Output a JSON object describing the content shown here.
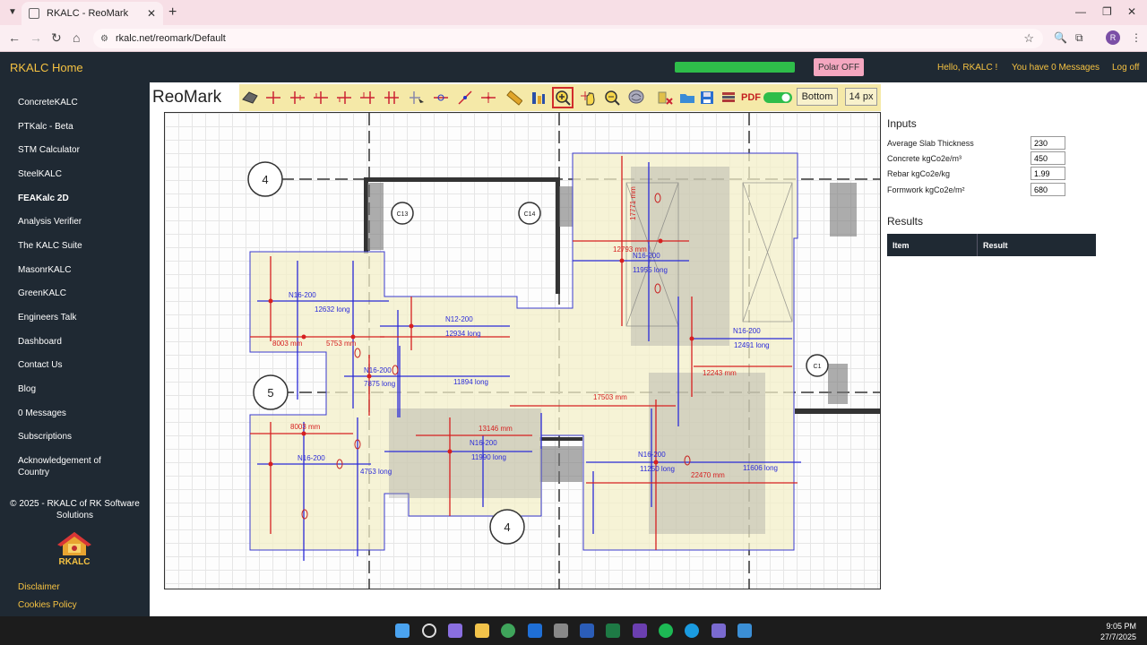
{
  "browser": {
    "tab_title": "RKALC - ReoMark",
    "url": "rkalc.net/reomark/Default",
    "avatar_letter": "R"
  },
  "header": {
    "brand": "RKALC Home",
    "progress_percent": 100,
    "polar_button": "Polar OFF",
    "greeting": "Hello, RKALC !",
    "messages": "You have 0 Messages",
    "logout": "Log off"
  },
  "sidebar": {
    "items": [
      {
        "label": "ConcreteKALC"
      },
      {
        "label": "PTKalc - Beta"
      },
      {
        "label": "STM Calculator"
      },
      {
        "label": "SteelKALC"
      },
      {
        "label": "FEAKalc 2D"
      },
      {
        "label": "Analysis Verifier"
      },
      {
        "label": "The KALC Suite"
      },
      {
        "label": "MasonrKALC"
      },
      {
        "label": "GreenKALC"
      },
      {
        "label": "Engineers Talk"
      },
      {
        "label": "Dashboard"
      },
      {
        "label": "Contact Us"
      },
      {
        "label": "Blog"
      },
      {
        "label": "0 Messages"
      },
      {
        "label": "Subscriptions"
      },
      {
        "label": "Acknowledgement of"
      }
    ],
    "ack_line2": "Country",
    "copyright_line1": "© 2025 - RKALC of RK Software",
    "copyright_line2": "Solutions",
    "logo_text": "RKALC",
    "disclaimer": "Disclaimer",
    "cookies": "Cookies Policy"
  },
  "main": {
    "title": "ReoMark",
    "toolbar": {
      "pdf_label": "PDF",
      "bottom_button": "Bottom",
      "px_button": "14 px"
    }
  },
  "drawing": {
    "grid_labels": [
      "4",
      "5",
      "4"
    ],
    "column_labels": [
      "C13",
      "C14",
      "C1"
    ],
    "bar_labels": [
      "N16-200",
      "12632 long",
      "N12-200",
      "12934 long",
      "N16-200",
      "11955 long",
      "N16-200",
      "12491 long",
      "N16-200",
      "7875 long",
      "11894 long",
      "17503 mm",
      "N16-200",
      "11990 long",
      "N16-200",
      "4753 long",
      "N16-200",
      "11250 long",
      "11606 long",
      "22470 mm",
      "13146 mm",
      "8003 mm",
      "5753 mm",
      "8003 mm",
      "12243 mm",
      "12793 mm",
      "17771 mm"
    ]
  },
  "inputs": {
    "heading": "Inputs",
    "fields": [
      {
        "label": "Average Slab Thickness",
        "value": "230"
      },
      {
        "label": "Concrete kgCo2e/m³",
        "value": "450"
      },
      {
        "label": "Rebar kgCo2e/kg",
        "value": "1.99"
      },
      {
        "label": "Formwork kgCo2e/m²",
        "value": "680"
      }
    ]
  },
  "results": {
    "heading": "Results",
    "col_item": "Item",
    "col_result": "Result"
  },
  "taskbar": {
    "time": "9:05 PM",
    "date": "27/7/2025"
  },
  "colors": {
    "header_bg": "#1f2933",
    "brand": "#f5c242",
    "toolbar_bg": "#f5e9a8",
    "slab_fill": "#f3efc8",
    "rebar_blue": "#2b2bd8",
    "dim_red": "#d62020"
  }
}
